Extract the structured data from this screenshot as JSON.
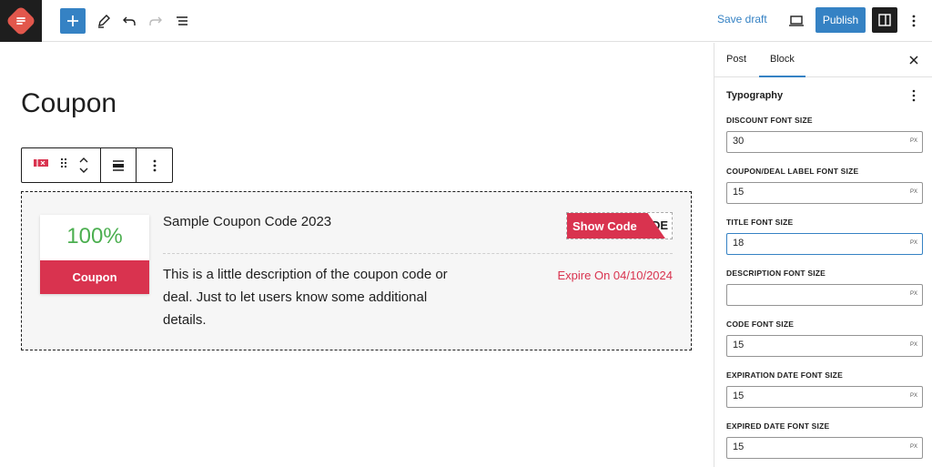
{
  "topbar": {
    "save_draft_label": "Save draft",
    "publish_label": "Publish"
  },
  "editor": {
    "page_title": "Coupon"
  },
  "coupon": {
    "discount": "100%",
    "discount_label": "Coupon",
    "title": "Sample Coupon Code 2023",
    "show_code_label": "Show Code",
    "code_peek": "DE",
    "description": "This is a little description of the coupon code or deal. Just to let users know some additional details.",
    "expire_text": "Expire On 04/10/2024"
  },
  "sidebar": {
    "tabs": [
      {
        "label": "Post",
        "active": false
      },
      {
        "label": "Block",
        "active": true
      }
    ],
    "section_title": "Typography",
    "fields": [
      {
        "label": "DISCOUNT FONT SIZE",
        "value": "30",
        "unit": "PX"
      },
      {
        "label": "COUPON/DEAL LABEL FONT SIZE",
        "value": "15",
        "unit": "PX"
      },
      {
        "label": "TITLE FONT SIZE",
        "value": "18",
        "unit": "PX"
      },
      {
        "label": "DESCRIPTION FONT SIZE",
        "value": "",
        "unit": "PX"
      },
      {
        "label": "CODE FONT SIZE",
        "value": "15",
        "unit": "PX"
      },
      {
        "label": "EXPIRATION DATE FONT SIZE",
        "value": "15",
        "unit": "PX"
      },
      {
        "label": "EXPIRED DATE FONT SIZE",
        "value": "15",
        "unit": "PX"
      }
    ]
  },
  "colors": {
    "accent": "#3582c4",
    "coupon_red": "#d9334f",
    "discount_green": "#4caf50"
  }
}
